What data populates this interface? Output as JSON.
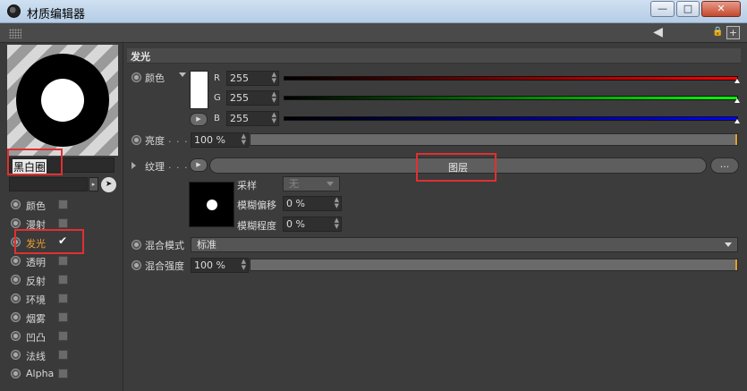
{
  "window": {
    "title": "材质编辑器",
    "minimize": "—",
    "maximize": "□",
    "close": "✕"
  },
  "toolbar": {
    "nav_back": "◀",
    "lock": "🔒",
    "new": "+"
  },
  "material": {
    "name": "黑白圈"
  },
  "channels": [
    {
      "label": "颜色",
      "checked": false
    },
    {
      "label": "漫射",
      "checked": false
    },
    {
      "label": "发光",
      "checked": true
    },
    {
      "label": "透明",
      "checked": false
    },
    {
      "label": "反射",
      "checked": false
    },
    {
      "label": "环境",
      "checked": false
    },
    {
      "label": "烟雾",
      "checked": false
    },
    {
      "label": "凹凸",
      "checked": false
    },
    {
      "label": "法线",
      "checked": false
    },
    {
      "label": "Alpha",
      "checked": false
    }
  ],
  "luminance": {
    "section_title": "发光",
    "color_label": "颜色",
    "r_label": "R",
    "r_value": "255",
    "g_label": "G",
    "g_value": "255",
    "b_label": "B",
    "b_value": "255",
    "brightness_label": "亮度",
    "brightness_value": "100 %",
    "texture_label": "纹理",
    "texture_button": "图层",
    "more_button": "...",
    "sampling_label": "采样",
    "sampling_value": "无",
    "blur_offset_label": "模糊偏移",
    "blur_offset_value": "0 %",
    "blur_scale_label": "模糊程度",
    "blur_scale_value": "0 %",
    "mix_mode_label": "混合模式",
    "mix_mode_value": "标准",
    "mix_strength_label": "混合强度",
    "mix_strength_value": "100 %",
    "dots": ". . ."
  },
  "colors": {
    "accent": "#f0a030",
    "highlight_box": "#e03030"
  }
}
